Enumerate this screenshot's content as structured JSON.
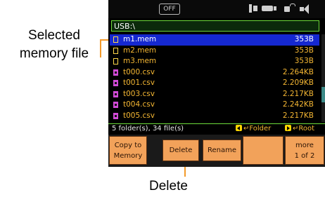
{
  "callouts": {
    "selected_line1": "Selected",
    "selected_line2": "memory file",
    "delete": "Delete"
  },
  "status": {
    "off_badge": "OFF"
  },
  "path": "USB:\\",
  "files": [
    {
      "name": "m1.mem",
      "size": "353B",
      "type": "mem",
      "selected": true
    },
    {
      "name": "m2.mem",
      "size": "353B",
      "type": "mem"
    },
    {
      "name": "m3.mem",
      "size": "353B",
      "type": "mem"
    },
    {
      "name": "t000.csv",
      "size": "2.264KB",
      "type": "csv"
    },
    {
      "name": "t001.csv",
      "size": "2.209KB",
      "type": "csv"
    },
    {
      "name": "t003.csv",
      "size": "2.217KB",
      "type": "csv"
    },
    {
      "name": "t004.csv",
      "size": "2.242KB",
      "type": "csv"
    },
    {
      "name": "t005.csv",
      "size": "2.217KB",
      "type": "csv"
    }
  ],
  "info": {
    "count": "5 folder(s), 34 file(s)",
    "folder_nav": "↵Folder",
    "root_nav": "↵Root"
  },
  "softkeys": {
    "copy_line1": "Copy to",
    "copy_line2": "Memory",
    "delete": "Delete",
    "rename": "Rename",
    "more_line1": "more",
    "more_line2": "1 of 2"
  },
  "colors": {
    "accent_orange": "#f2a25a",
    "highlight_blue": "#1528d0",
    "file_text": "#f5b733",
    "path_border": "#6ddc3a"
  }
}
